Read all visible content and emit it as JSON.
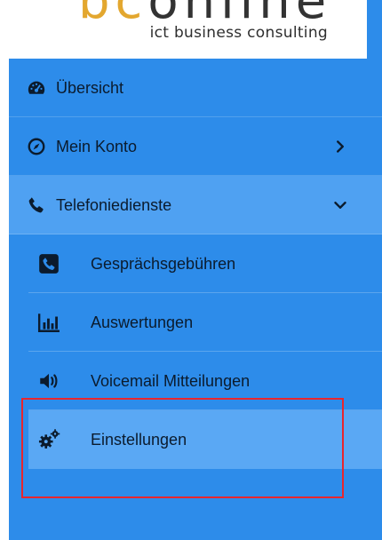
{
  "logo": {
    "mark_prefix": "bc",
    "mark_rest": "online",
    "tagline": "ict business consulting"
  },
  "nav": {
    "items": [
      {
        "label": "Übersicht",
        "icon": "dashboard-icon"
      },
      {
        "label": "Mein Konto",
        "icon": "compass-icon",
        "chevron": "chevron-right-icon"
      },
      {
        "label": "Telefoniedienste",
        "icon": "phone-icon",
        "chevron": "chevron-down-icon",
        "expanded": true
      }
    ],
    "subitems": [
      {
        "label": "Gesprächsgebühren",
        "icon": "phone-square-icon"
      },
      {
        "label": "Auswertungen",
        "icon": "bar-chart-icon"
      },
      {
        "label": "Voicemail Mitteilungen",
        "icon": "volume-icon"
      },
      {
        "label": "Einstellungen",
        "icon": "cogs-icon",
        "active": true
      }
    ]
  },
  "colors": {
    "sidebar_bg": "#2d8cea",
    "expanded_bg": "#4fa1f2",
    "active_bg": "#5aa8f4",
    "highlight_border": "#e8262e",
    "logo_gold": "#e3a72f"
  }
}
